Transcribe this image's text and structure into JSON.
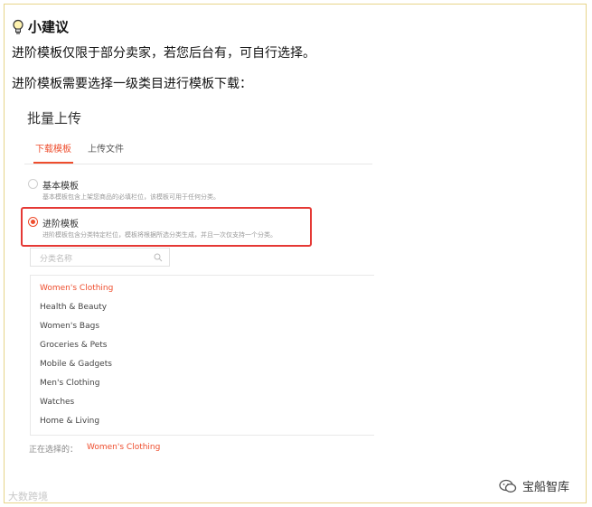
{
  "tip": {
    "title": "小建议",
    "line1": "进阶模板仅限于部分卖家，若您后台有，可自行选择。",
    "line2": "进阶模板需要选择一级类目进行模板下载："
  },
  "panel": {
    "title": "批量上传",
    "tabs": [
      {
        "label": "下载模板",
        "active": true
      },
      {
        "label": "上传文件",
        "active": false
      }
    ],
    "options": [
      {
        "label": "基本模板",
        "desc": "基本模板包含上架您商品的必填栏位，该模板可用于任何分类。",
        "selected": false
      },
      {
        "label": "进阶模板",
        "desc": "进阶模板包含分类特定栏位，模板将根据所选分类生成，并且一次仅支持一个分类。",
        "selected": true
      }
    ],
    "search_placeholder": "分类名称",
    "categories": [
      "Women's Clothing",
      "Health & Beauty",
      "Women's Bags",
      "Groceries & Pets",
      "Mobile & Gadgets",
      "Men's Clothing",
      "Watches",
      "Home & Living"
    ],
    "selected_category": "Women's Clothing",
    "current_label": "正在选择的：",
    "current_value": "Women's Clothing"
  },
  "watermarks": {
    "left": "大数跨境",
    "right": "宝船智库"
  },
  "colors": {
    "accent": "#ee4d2d",
    "highlight_border": "#e53935",
    "frame_border": "#e7d58a"
  }
}
